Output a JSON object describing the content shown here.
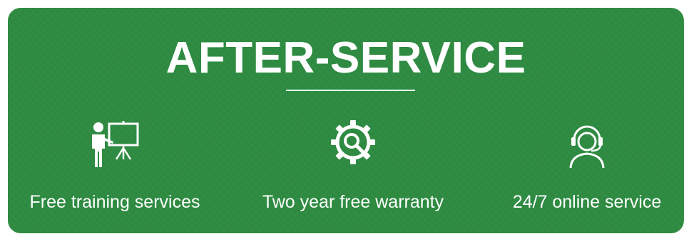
{
  "banner": {
    "title": "AFTER-SERVICE",
    "background_color": "#2e8b41",
    "text_color": "#ffffff",
    "features": [
      {
        "label": "Free training services",
        "icon": "presentation-icon"
      },
      {
        "label": "Two year free warranty",
        "icon": "gear-search-icon"
      },
      {
        "label": "24/7 online service",
        "icon": "headset-support-icon"
      }
    ]
  }
}
